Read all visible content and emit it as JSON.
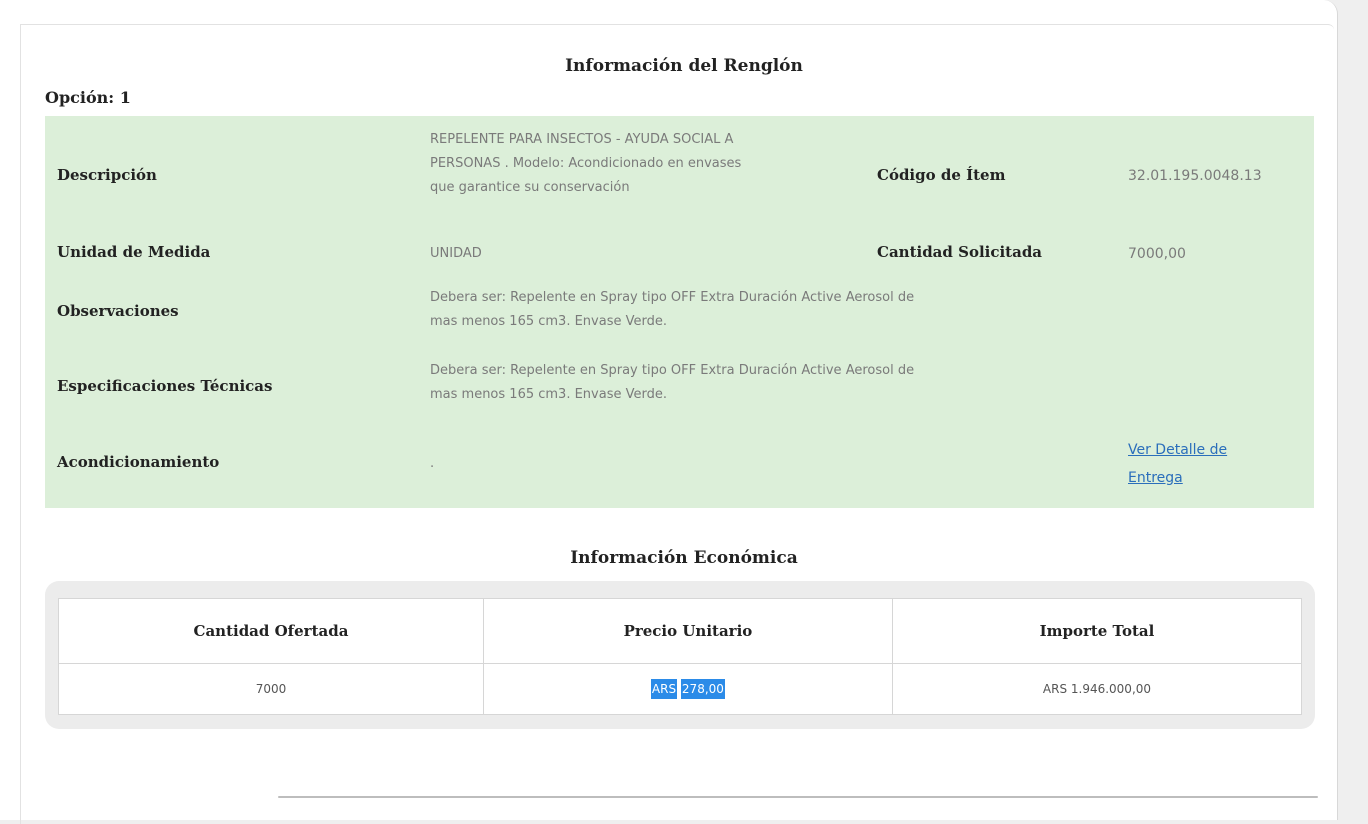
{
  "renglon": {
    "title": "Información del Renglón",
    "option": "Opción: 1",
    "descripcion_label": "Descripción",
    "descripcion_lines": [
      "REPELENTE PARA INSECTOS - AYUDA SOCIAL A",
      "PERSONAS . Modelo: Acondicionado en envases",
      "que garantice su conservación"
    ],
    "codigo_label": "Código de Ítem",
    "codigo_value": "32.01.195.0048.13",
    "unidad_label": "Unidad de Medida",
    "unidad_value": "UNIDAD",
    "cantidad_solicitada_label": "Cantidad Solicitada",
    "cantidad_solicitada_value": "7000,00",
    "observaciones_label": "Observaciones",
    "observaciones_lines": [
      "Debera ser: Repelente en Spray tipo OFF Extra Duración Active Aerosol de",
      "mas menos 165 cm3. Envase Verde."
    ],
    "especificaciones_label": "Especificaciones Técnicas",
    "especificaciones_lines": [
      "Debera ser: Repelente en Spray tipo OFF Extra Duración Active Aerosol de",
      "mas menos 165 cm3. Envase Verde."
    ],
    "acondicionamiento_label": "Acondicionamiento",
    "acondicionamiento_value": ".",
    "detalle_link_lines": [
      "Ver Detalle de",
      "Entrega"
    ]
  },
  "economica": {
    "title": "Información Económica",
    "headers": [
      "Cantidad Ofertada",
      "Precio Unitario",
      "Importe Total"
    ],
    "cantidad_ofertada": "7000",
    "precio_currency": "ARS",
    "precio_amount": "278,00",
    "importe_total": "ARS 1.946.000,00"
  },
  "colors": {
    "info_bg": "#dcefd9",
    "link": "#2a6ebb",
    "highlight": "#2b8be8"
  }
}
